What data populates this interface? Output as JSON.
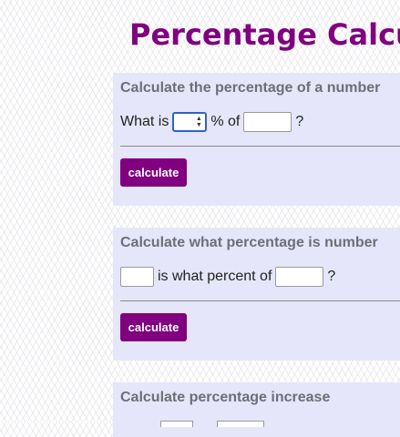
{
  "page": {
    "title": "Percentage Calcu"
  },
  "calculators": [
    {
      "heading": "Calculate the percentage of a number",
      "text_before": "What is",
      "text_middle": "% of",
      "text_after": "?",
      "first_input_value": "",
      "second_input_value": "",
      "button_label": "calculate"
    },
    {
      "heading": "Calculate what percentage is number",
      "text_middle": "is what percent of",
      "text_after": "?",
      "first_input_value": "",
      "second_input_value": "",
      "button_label": "calculate"
    },
    {
      "heading": "Calculate percentage increase"
    }
  ],
  "colors": {
    "title": "#800080",
    "button": "#800080",
    "card_background": "#e6e6fa",
    "heading_text": "#6e6e78",
    "focus_border": "#2f62c9"
  },
  "icons": {
    "spinner": "up-down-arrows-icon"
  }
}
